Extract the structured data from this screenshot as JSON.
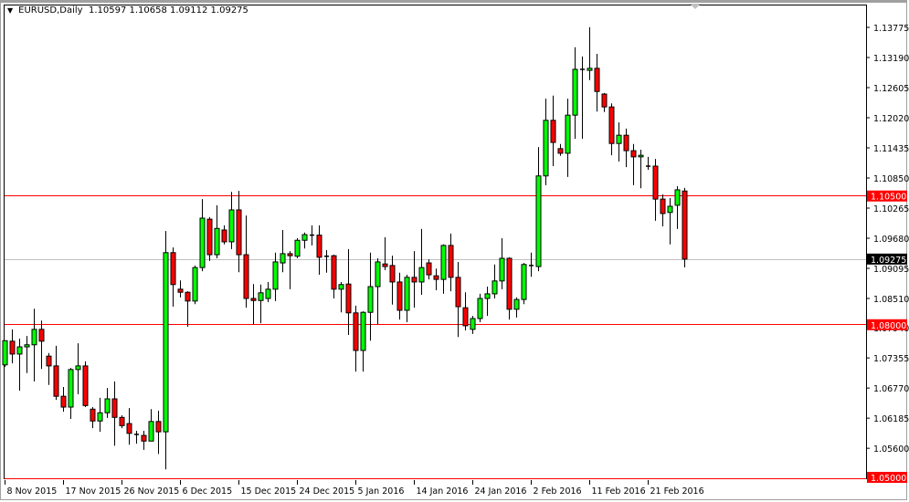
{
  "header": {
    "symbol_timeframe": "EURUSD,Daily",
    "ohlc_readout": "1.10597 1.10658 1.09112 1.09275",
    "menu_icon": "triangle-down-icon"
  },
  "colors": {
    "bull": "#00ff00",
    "bear": "#ff0000",
    "outline": "#000000",
    "level_line": "#ff0000",
    "bid_line": "#c0c0c0",
    "bid_label_bg": "#000000"
  },
  "chart_data": {
    "type": "candlestick",
    "title": "EURUSD,Daily",
    "ylim": [
      1.05,
      1.14218
    ],
    "grid": false,
    "y_ticks": [
      "1.13775",
      "1.13190",
      "1.12605",
      "1.12020",
      "1.11435",
      "1.10850",
      "1.10265",
      "1.09680",
      "1.09095",
      "1.08510",
      "1.07940",
      "1.07355",
      "1.06770",
      "1.06185",
      "1.05600"
    ],
    "x_labels": [
      {
        "label": "8 Nov 2015",
        "index": 0
      },
      {
        "label": "17 Nov 2015",
        "index": 8
      },
      {
        "label": "26 Nov 2015",
        "index": 16
      },
      {
        "label": "6 Dec 2015",
        "index": 24
      },
      {
        "label": "15 Dec 2015",
        "index": 32
      },
      {
        "label": "24 Dec 2015",
        "index": 40
      },
      {
        "label": "5 Jan 2016",
        "index": 48
      },
      {
        "label": "14 Jan 2016",
        "index": 56
      },
      {
        "label": "24 Jan 2016",
        "index": 64
      },
      {
        "label": "2 Feb 2016",
        "index": 72
      },
      {
        "label": "11 Feb 2016",
        "index": 80
      },
      {
        "label": "21 Feb 2016",
        "index": 88
      }
    ],
    "levels": [
      {
        "price": 1.105,
        "label": "1.10500",
        "kind": "resistance"
      },
      {
        "price": 1.08,
        "label": "1.08000",
        "kind": "support"
      },
      {
        "price": 1.05,
        "label": "1.05000",
        "kind": "support"
      }
    ],
    "bid": {
      "price": 1.09275,
      "label": "1.09275"
    },
    "ohlc": [
      [
        1.0722,
        1.0769,
        1.0718,
        1.0769
      ],
      [
        1.0768,
        1.0791,
        1.0725,
        1.0743
      ],
      [
        1.0743,
        1.0773,
        1.0672,
        1.0757
      ],
      [
        1.0757,
        1.0778,
        1.0706,
        1.0761
      ],
      [
        1.0761,
        1.0831,
        1.069,
        1.0791
      ],
      [
        1.0791,
        1.0808,
        1.0714,
        1.0768
      ],
      [
        1.0739,
        1.0745,
        1.0683,
        1.072
      ],
      [
        1.072,
        1.0759,
        1.0654,
        1.0661
      ],
      [
        1.0661,
        1.0679,
        1.0631,
        1.064
      ],
      [
        1.064,
        1.0716,
        1.0617,
        1.0713
      ],
      [
        1.0713,
        1.0764,
        1.0665,
        1.072
      ],
      [
        1.072,
        1.0729,
        1.064,
        1.0643
      ],
      [
        1.0636,
        1.064,
        1.0599,
        1.0613
      ],
      [
        1.0613,
        1.0658,
        1.0592,
        1.0629
      ],
      [
        1.0629,
        1.0677,
        1.0619,
        1.0656
      ],
      [
        1.0656,
        1.069,
        1.0565,
        1.062
      ],
      [
        1.062,
        1.0624,
        1.0599,
        1.0604
      ],
      [
        1.0608,
        1.0638,
        1.0567,
        1.0589
      ],
      [
        1.0587,
        1.0594,
        1.0569,
        1.0585
      ],
      [
        1.0585,
        1.0594,
        1.0557,
        1.0574
      ],
      [
        1.0574,
        1.0636,
        1.0574,
        1.0612
      ],
      [
        1.0612,
        1.0633,
        1.0549,
        1.0592
      ],
      [
        1.0592,
        1.0982,
        1.0519,
        1.094
      ],
      [
        1.094,
        1.095,
        1.0835,
        1.0878
      ],
      [
        1.0869,
        1.0886,
        1.0853,
        1.0863
      ],
      [
        1.0863,
        1.0865,
        1.0796,
        1.0846
      ],
      [
        1.0846,
        1.0915,
        1.084,
        1.0911
      ],
      [
        1.0911,
        1.1044,
        1.0904,
        1.1007
      ],
      [
        1.1005,
        1.1009,
        1.0924,
        1.0936
      ],
      [
        1.0936,
        1.1032,
        1.0929,
        1.0987
      ],
      [
        1.0984,
        1.0993,
        1.0956,
        1.0961
      ],
      [
        1.0961,
        1.1058,
        1.0947,
        1.1023
      ],
      [
        1.1023,
        1.106,
        1.0902,
        1.0936
      ],
      [
        1.0936,
        1.1012,
        1.0833,
        1.0851
      ],
      [
        1.0851,
        1.0879,
        1.0801,
        1.0847
      ],
      [
        1.0847,
        1.0878,
        1.0803,
        1.0862
      ],
      [
        1.0851,
        1.0883,
        1.0844,
        1.0869
      ],
      [
        1.0869,
        1.094,
        1.0846,
        1.0922
      ],
      [
        1.092,
        1.0984,
        1.0902,
        1.0938
      ],
      [
        1.0938,
        1.0943,
        1.0869,
        1.0934
      ],
      [
        1.0933,
        1.0968,
        1.0929,
        1.0964
      ],
      [
        1.0964,
        1.0979,
        1.0948,
        1.0975
      ],
      [
        1.0974,
        1.0993,
        1.0954,
        1.0973
      ],
      [
        1.0974,
        1.0993,
        1.0897,
        1.0931
      ],
      [
        1.0933,
        1.0945,
        1.0901,
        1.0932
      ],
      [
        1.0934,
        1.0936,
        1.0851,
        1.0869
      ],
      [
        1.0869,
        1.0883,
        1.0824,
        1.0878
      ],
      [
        1.0879,
        1.0947,
        1.078,
        1.0823
      ],
      [
        1.0823,
        1.0837,
        1.0709,
        1.075
      ],
      [
        1.075,
        1.0826,
        1.0709,
        1.0824
      ],
      [
        1.0824,
        1.094,
        1.0769,
        1.0874
      ],
      [
        1.0874,
        1.0929,
        1.0801,
        1.0922
      ],
      [
        1.0918,
        1.097,
        1.0906,
        1.0913
      ],
      [
        1.0915,
        1.0934,
        1.0839,
        1.0883
      ],
      [
        1.0883,
        1.0901,
        1.081,
        1.0828
      ],
      [
        1.0828,
        1.0897,
        1.0805,
        1.0892
      ],
      [
        1.0892,
        1.0943,
        1.0833,
        1.0883
      ],
      [
        1.0883,
        1.0986,
        1.0858,
        1.0911
      ],
      [
        1.092,
        1.0927,
        1.0888,
        1.0897
      ],
      [
        1.0895,
        1.0909,
        1.0867,
        1.0888
      ],
      [
        1.0888,
        1.0956,
        1.086,
        1.0954
      ],
      [
        1.0954,
        1.0977,
        1.0865,
        1.0892
      ],
      [
        1.0892,
        1.0922,
        1.0776,
        1.0835
      ],
      [
        1.0833,
        1.0863,
        1.0789,
        1.0798
      ],
      [
        1.0791,
        1.0817,
        1.0782,
        1.0812
      ],
      [
        1.0812,
        1.086,
        1.0805,
        1.0851
      ],
      [
        1.0851,
        1.0874,
        1.0817,
        1.086
      ],
      [
        1.086,
        1.0917,
        1.0851,
        1.0885
      ],
      [
        1.0885,
        1.0968,
        1.0869,
        1.0929
      ],
      [
        1.0929,
        1.0931,
        1.081,
        1.083
      ],
      [
        1.083,
        1.0853,
        1.0814,
        1.0849
      ],
      [
        1.0849,
        1.092,
        1.084,
        1.0917
      ],
      [
        1.0915,
        1.094,
        1.0893,
        1.0914
      ],
      [
        1.0913,
        1.1145,
        1.0904,
        1.1089
      ],
      [
        1.1089,
        1.1239,
        1.1071,
        1.1197
      ],
      [
        1.1197,
        1.1245,
        1.1108,
        1.1154
      ],
      [
        1.1142,
        1.1151,
        1.1128,
        1.1133
      ],
      [
        1.1133,
        1.1239,
        1.1087,
        1.1207
      ],
      [
        1.1207,
        1.1339,
        1.1161,
        1.1296
      ],
      [
        1.1296,
        1.1321,
        1.1161,
        1.1294
      ],
      [
        1.1294,
        1.1378,
        1.1275,
        1.1298
      ],
      [
        1.1298,
        1.1326,
        1.1214,
        1.1253
      ],
      [
        1.1248,
        1.125,
        1.1213,
        1.1223
      ],
      [
        1.1223,
        1.123,
        1.1129,
        1.1152
      ],
      [
        1.1152,
        1.1193,
        1.1117,
        1.1168
      ],
      [
        1.1168,
        1.1181,
        1.1106,
        1.1138
      ],
      [
        1.1138,
        1.1151,
        1.1071,
        1.1126
      ],
      [
        1.1126,
        1.114,
        1.1065,
        1.1129
      ],
      [
        1.1108,
        1.1126,
        1.1101,
        1.1107
      ],
      [
        1.1108,
        1.1122,
        1.1002,
        1.1044
      ],
      [
        1.1044,
        1.1053,
        1.0991,
        1.1016
      ],
      [
        1.1018,
        1.1046,
        1.0956,
        1.103
      ],
      [
        1.1032,
        1.1069,
        1.0986,
        1.1062
      ],
      [
        1.10597,
        1.10658,
        1.09112,
        1.09275
      ]
    ]
  }
}
